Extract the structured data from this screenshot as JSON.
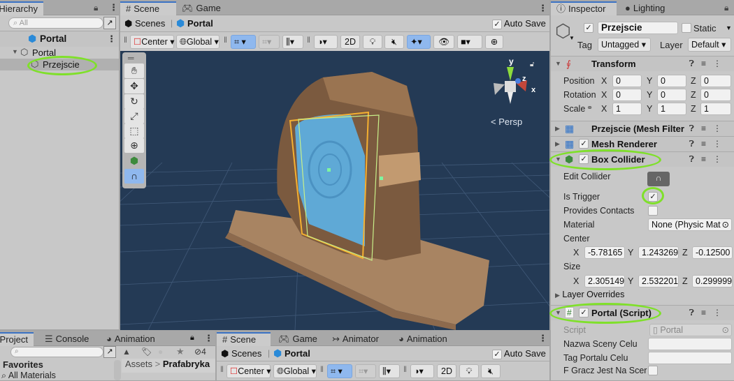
{
  "hierarchy": {
    "tab_label": "Hierarchy",
    "search_placeholder": "All",
    "scene_name": "Portal",
    "items": [
      {
        "label": "Portal",
        "expanded": true
      },
      {
        "label": "Przejscie",
        "selected": true
      }
    ]
  },
  "scene_view": {
    "tabs": [
      {
        "label": "Scene",
        "icon": "grid-icon",
        "active": true
      },
      {
        "label": "Game",
        "icon": "gamepad-icon",
        "active": false
      }
    ],
    "breadcrumb": {
      "root": "Scenes",
      "current": "Portal"
    },
    "auto_save_label": "Auto Save",
    "auto_save": true,
    "toolbar": {
      "pivot": "Center",
      "space": "Global",
      "mode_2d": "2D"
    },
    "tools": [
      "hand-tool",
      "move-tool",
      "rotate-tool",
      "scale-tool",
      "rect-tool",
      "transform-tool",
      "box-collider-tool",
      "edit-collider-tool"
    ],
    "gizmo": {
      "y": "y",
      "x": "x",
      "z": "z",
      "projection": "Persp"
    }
  },
  "inspector": {
    "tabs": [
      {
        "label": "Inspector",
        "active": true
      },
      {
        "label": "Lighting",
        "active": false
      }
    ],
    "object": {
      "active": true,
      "name": "Przejscie",
      "static_label": "Static",
      "static": false,
      "tag_label": "Tag",
      "tag": "Untagged",
      "layer_label": "Layer",
      "layer": "Default"
    },
    "transform": {
      "title": "Transform",
      "position_label": "Position",
      "rotation_label": "Rotation",
      "scale_label": "Scale",
      "position": {
        "x": "0",
        "y": "0",
        "z": "0"
      },
      "rotation": {
        "x": "0",
        "y": "0",
        "z": "0"
      },
      "scale": {
        "x": "1",
        "y": "1",
        "z": "1"
      }
    },
    "mesh_filter": {
      "title": "Przejscie (Mesh Filter"
    },
    "mesh_renderer": {
      "title": "Mesh Renderer",
      "enabled": true
    },
    "box_collider": {
      "title": "Box Collider",
      "enabled": true,
      "edit_collider_label": "Edit Collider",
      "is_trigger_label": "Is Trigger",
      "is_trigger": true,
      "provides_contacts_label": "Provides Contacts",
      "provides_contacts": false,
      "material_label": "Material",
      "material": "None (Physic Mat",
      "center_label": "Center",
      "center": {
        "x": "-5.78165",
        "y": "1.243269",
        "z": "-0.12500"
      },
      "size_label": "Size",
      "size": {
        "x": "2.305149",
        "y": "2.532201",
        "z": "0.299999"
      },
      "layer_overrides_label": "Layer Overrides"
    },
    "portal_script": {
      "title": "Portal (Script)",
      "enabled": true,
      "script_label": "Script",
      "script": "Portal",
      "fields": [
        {
          "label": "Nazwa Sceny Celu",
          "value": ""
        },
        {
          "label": "Tag Portalu Celu",
          "value": ""
        },
        {
          "label": "F Gracz Jest Na Scer",
          "checkbox": false
        }
      ]
    }
  },
  "project": {
    "tabs": [
      {
        "label": "Project",
        "active": true
      },
      {
        "label": "Console",
        "active": false
      },
      {
        "label": "Animation",
        "active": false
      }
    ],
    "hidden_count": "4",
    "favorites_label": "Favorites",
    "favorites": [
      "All Materials"
    ],
    "breadcrumb": {
      "root": "Assets",
      "current": "Prafabryka"
    }
  },
  "scene_view_2": {
    "tabs": [
      {
        "label": "Scene",
        "active": true
      },
      {
        "label": "Game",
        "active": false
      },
      {
        "label": "Animator",
        "active": false
      },
      {
        "label": "Animation",
        "active": false
      }
    ],
    "breadcrumb": {
      "root": "Scenes",
      "current": "Portal"
    },
    "auto_save_label": "Auto Save",
    "toolbar": {
      "pivot": "Center",
      "space": "Global",
      "mode_2d": "2D"
    }
  },
  "colors": {
    "accent": "#3a72c4",
    "highlight_oval": "#7fe02a",
    "scene_bg": "#243a55",
    "selection": "#b0b0b0"
  }
}
